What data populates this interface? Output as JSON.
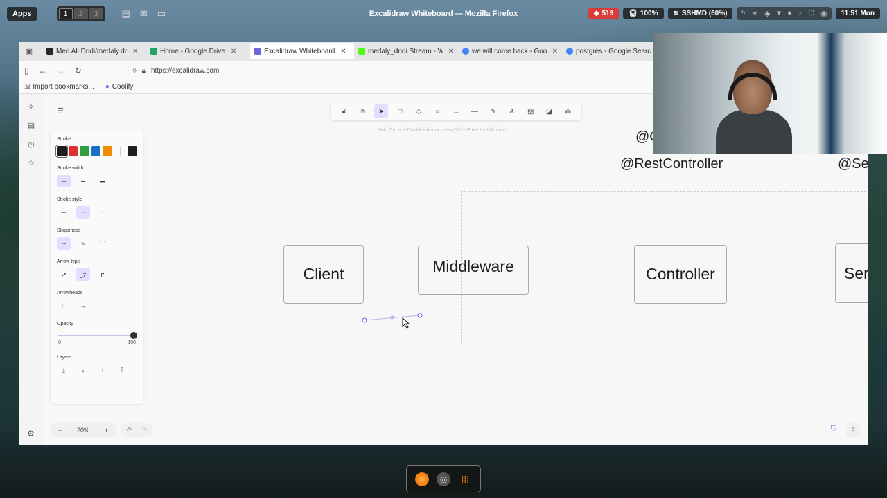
{
  "panel": {
    "apps_label": "Apps",
    "workspaces": [
      "1",
      "2",
      "3"
    ],
    "window_title": "Excalidraw Whiteboard — Mozilla Firefox",
    "notifications_count": "519",
    "volume": "100%",
    "wifi": "SSHMD (60%)",
    "clock": "11:51 Mon"
  },
  "browser": {
    "tabs": [
      {
        "label": "Med Ali Dridi/medaly.dr",
        "color": "#24292e",
        "active": false
      },
      {
        "label": "Home - Google Drive",
        "color": "#1fa463",
        "active": false
      },
      {
        "label": "Excalidraw Whiteboard",
        "color": "#6965db",
        "active": true
      },
      {
        "label": "medaly_dridi Stream - W",
        "color": "#53fc18",
        "active": false
      },
      {
        "label": "we will come back - Goo",
        "color": "#4285f4",
        "active": false
      },
      {
        "label": "postgres - Google Searc",
        "color": "#4285f4",
        "active": false
      }
    ],
    "url": "https://excalidraw.com",
    "bookmarks": [
      "Import bookmarks...",
      "Coolify"
    ]
  },
  "excalidraw": {
    "hint_text": "Hold Ctrl and Double-click or press Ctrl + Enter to edit points",
    "props": {
      "stroke_label": "Stroke",
      "stroke_colors": [
        "#1e1e1e",
        "#e03131",
        "#2f9e44",
        "#1971c2",
        "#f08c00"
      ],
      "current_stroke": "#1e1e1e",
      "stroke_width_label": "Stroke width",
      "stroke_style_label": "Stroke style",
      "sloppiness_label": "Sloppiness",
      "arrow_type_label": "Arrow type",
      "arrowheads_label": "Arrowheads",
      "opacity_label": "Opacity",
      "opacity_min": "0",
      "opacity_max": "100",
      "opacity_value": 100,
      "layers_label": "Layers"
    },
    "zoom": "20%",
    "diagram": {
      "boxes": {
        "client": "Client",
        "middleware": "Middleware",
        "controller": "Controller",
        "service": "Servi"
      },
      "annotations": {
        "rest_controller": "@RestController",
        "component_partial": "@Cor",
        "service_partial": "@Servi"
      }
    }
  }
}
